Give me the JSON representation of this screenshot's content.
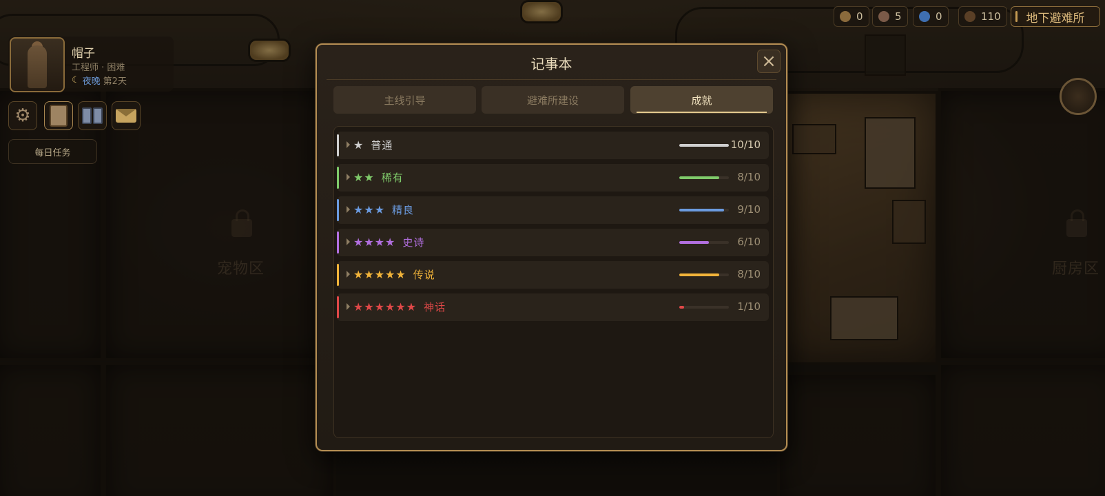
{
  "hud": {
    "resources": [
      {
        "icon": "gear-parts-icon",
        "value": "0",
        "color": "#8a6a3c"
      },
      {
        "icon": "ore-icon",
        "value": "5",
        "color": "#7a5a48"
      },
      {
        "icon": "water-icon",
        "value": "0",
        "color": "#3f6fb0"
      },
      {
        "icon": "food-icon",
        "value": "110",
        "color": "#5a3f26"
      }
    ],
    "shelter_button": "地下避难所"
  },
  "character": {
    "name": "帽子",
    "subtitle": "工程师 · 困难",
    "time_of_day": "夜晚",
    "day": "第2天"
  },
  "toolbar": {
    "daily_tasks": "每日任务"
  },
  "zones": {
    "pet": "宠物区",
    "kitchen": "厨房区"
  },
  "modal": {
    "title": "记事本",
    "close_glyph": "×",
    "tabs": [
      {
        "label": "主线引导",
        "active": false
      },
      {
        "label": "避难所建设",
        "active": false
      },
      {
        "label": "成就",
        "active": true
      }
    ],
    "rows": [
      {
        "stars": "★",
        "tier": "普通",
        "count": "10/10",
        "progress": 1.0,
        "color": "#cfcfcf"
      },
      {
        "stars": "★★",
        "tier": "稀有",
        "count": "8/10",
        "progress": 0.8,
        "color": "#7fca6a"
      },
      {
        "stars": "★★★",
        "tier": "精良",
        "count": "9/10",
        "progress": 0.9,
        "color": "#6b9be0"
      },
      {
        "stars": "★★★★",
        "tier": "史诗",
        "count": "6/10",
        "progress": 0.6,
        "color": "#b26fe0"
      },
      {
        "stars": "★★★★★",
        "tier": "传说",
        "count": "8/10",
        "progress": 0.8,
        "color": "#f2b43a"
      },
      {
        "stars": "★★★★★★",
        "tier": "神话",
        "count": "1/10",
        "progress": 0.1,
        "color": "#e04848"
      }
    ]
  }
}
